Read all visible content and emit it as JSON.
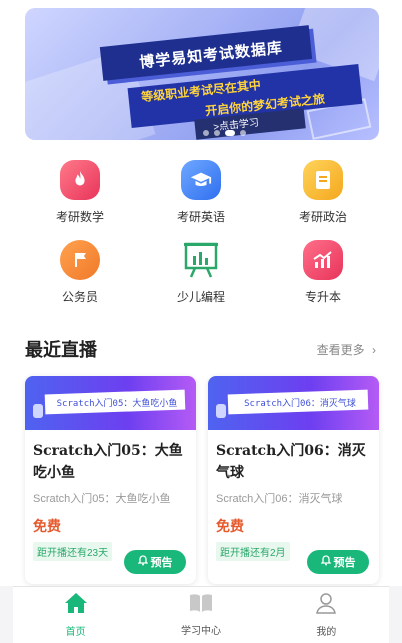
{
  "banner": {
    "title": "博学易知考试数据库",
    "subtitle_line1": "等级职业考试尽在其中",
    "subtitle_line2": "开启你的梦幻考试之旅",
    "cta": ">点击学习"
  },
  "categories": [
    {
      "label": "考研数学",
      "icon": "flame-icon",
      "color": "#f04e66"
    },
    {
      "label": "考研英语",
      "icon": "graduation-cap-icon",
      "color": "#3f82f6"
    },
    {
      "label": "考研政治",
      "icon": "document-icon",
      "color": "#f6b42a"
    },
    {
      "label": "公务员",
      "icon": "flag-icon",
      "color": "#f58a2e"
    },
    {
      "label": "少儿编程",
      "icon": "bar-chart-board-icon",
      "color": "#2aa86a"
    },
    {
      "label": "专升本",
      "icon": "trend-chart-icon",
      "color": "#f04e66"
    }
  ],
  "live": {
    "title": "最近直播",
    "more": "查看更多"
  },
  "courses": [
    {
      "thumb_text": "Scratch入门05：大鱼吃小鱼",
      "name": "Scratch入门05：大鱼吃小鱼",
      "desc": "Scratch入门05：大鱼吃小鱼",
      "price": "免费",
      "countdown": "距开播还有23天",
      "button": "预告"
    },
    {
      "thumb_text": "Scratch入门06：消灭气球",
      "name": "Scratch入门06：消灭气球",
      "desc": "Scratch入门06：消灭气球",
      "price": "免费",
      "countdown": "距开播还有2月",
      "button": "预告"
    }
  ],
  "tabs": [
    {
      "label": "首页",
      "icon": "home-icon",
      "active": true
    },
    {
      "label": "学习中心",
      "icon": "book-icon",
      "active": false
    },
    {
      "label": "我的",
      "icon": "user-icon",
      "active": false
    }
  ],
  "colors": {
    "accent": "#19b77a",
    "price": "#e55a2e"
  }
}
